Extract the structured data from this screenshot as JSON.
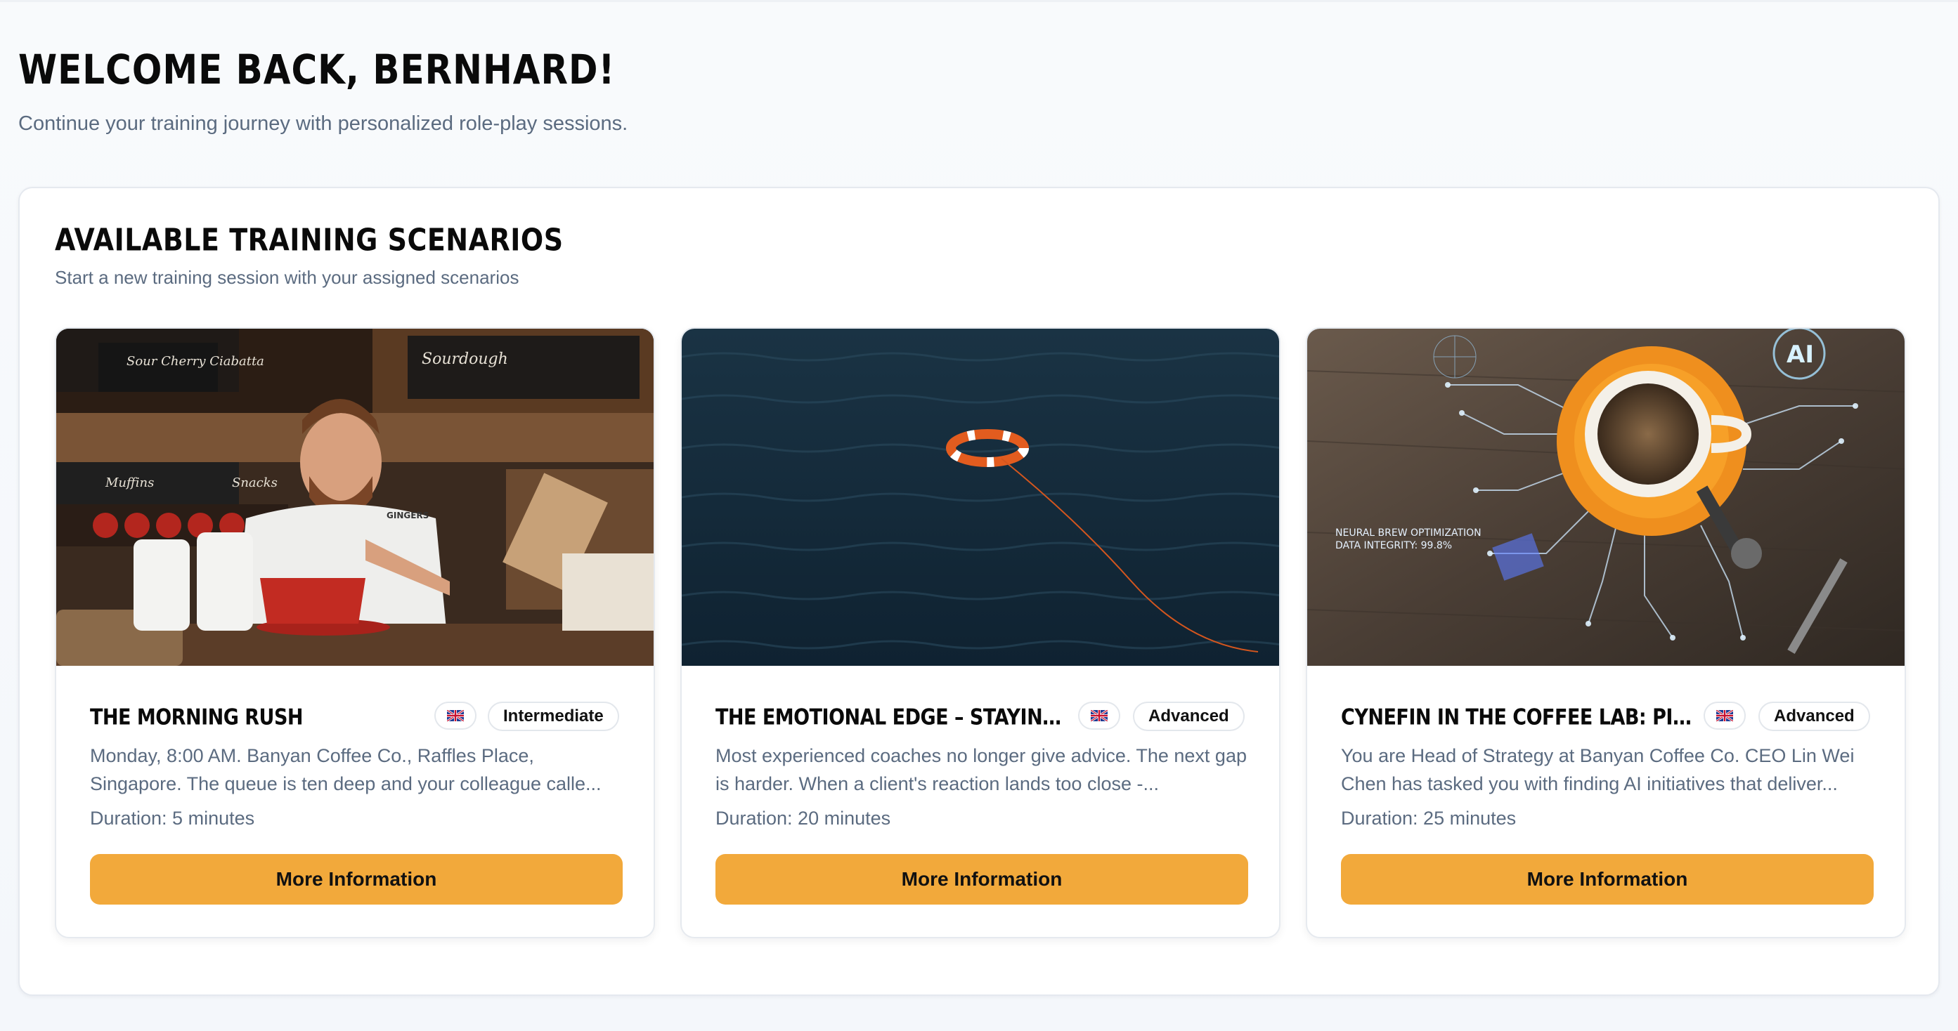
{
  "header": {
    "title": "WELCOME BACK, BERNHARD!",
    "subtitle": "Continue your training journey with personalized role-play sessions."
  },
  "scenarios_panel": {
    "title": "AVAILABLE TRAINING SCENARIOS",
    "subtitle": "Start a new training session with your assigned scenarios"
  },
  "cards": [
    {
      "title": "THE MORNING RUSH",
      "language_icon": "uk-flag-icon",
      "level": "Intermediate",
      "description": "Monday, 8:00 AM. Banyan Coffee Co., Raffles Place, Singapore. The queue is ten deep and your colleague calle...",
      "duration": "Duration: 5 minutes",
      "button_label": "More Information"
    },
    {
      "title": "THE EMOTIONAL EDGE – STAYING IN TH...",
      "language_icon": "uk-flag-icon",
      "level": "Advanced",
      "description": "Most experienced coaches no longer give advice. The next gap is harder. When a client's reaction lands too close -...",
      "duration": "Duration: 20 minutes",
      "button_label": "More Information"
    },
    {
      "title": "CYNEFIN IN THE COFFEE LAB: PICKING ...",
      "language_icon": "uk-flag-icon",
      "level": "Advanced",
      "description": "You are Head of Strategy at Banyan Coffee Co. CEO Lin Wei Chen has tasked you with finding AI initiatives that deliver...",
      "duration": "Duration: 25 minutes",
      "button_label": "More Information"
    }
  ],
  "image_text": {
    "card1_sign_left": "Sour Cherry Ciabatta",
    "card1_sign_right": "Sourdough",
    "card1_sign_lower": "Muffins",
    "card1_sign_lower2": "Snacks",
    "card1_shirt": "GINGERS",
    "card3_ai": "AI",
    "card3_caption_1": "NEURAL BREW OPTIMIZATION",
    "card3_caption_2": "DATA INTEGRITY: 99.8%"
  },
  "colors": {
    "accent": "#f2a93b",
    "muted_text": "#5b6b80",
    "border": "#e5e9ef"
  }
}
